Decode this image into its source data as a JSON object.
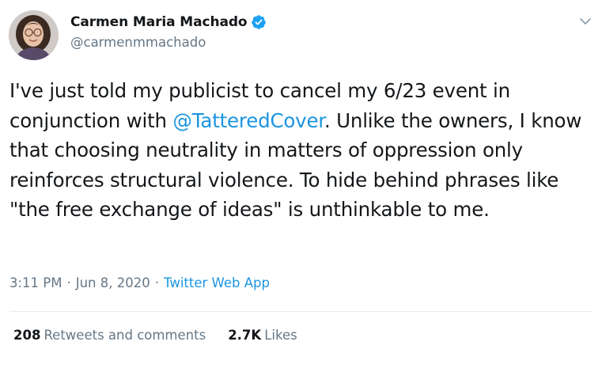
{
  "author": {
    "display_name": "Carmen Maria Machado",
    "handle": "@carmenmmachado",
    "verified": true
  },
  "tweet": {
    "text_before": "I've just told my publicist to cancel my 6/23 event in conjunction with ",
    "mention": "@TatteredCover",
    "text_after": ". Unlike the owners, I know that choosing neutrality in matters of oppression only reinforces structural violence. To hide behind phrases like \"the free exchange of ideas\" is unthinkable to me."
  },
  "meta": {
    "time": "3:11 PM",
    "separator": "·",
    "date": "Jun 8, 2020",
    "source": "Twitter Web App"
  },
  "stats": {
    "retweets_count": "208",
    "retweets_label": "Retweets and comments",
    "likes_count": "2.7K",
    "likes_label": "Likes"
  },
  "colors": {
    "text": "#14171a",
    "secondary": "#657786",
    "link": "#1b95e0",
    "verified": "#1da1f2",
    "divider": "#e6ecf0"
  },
  "icons": {
    "verified": "verified-badge-icon",
    "caret": "chevron-down-icon"
  }
}
